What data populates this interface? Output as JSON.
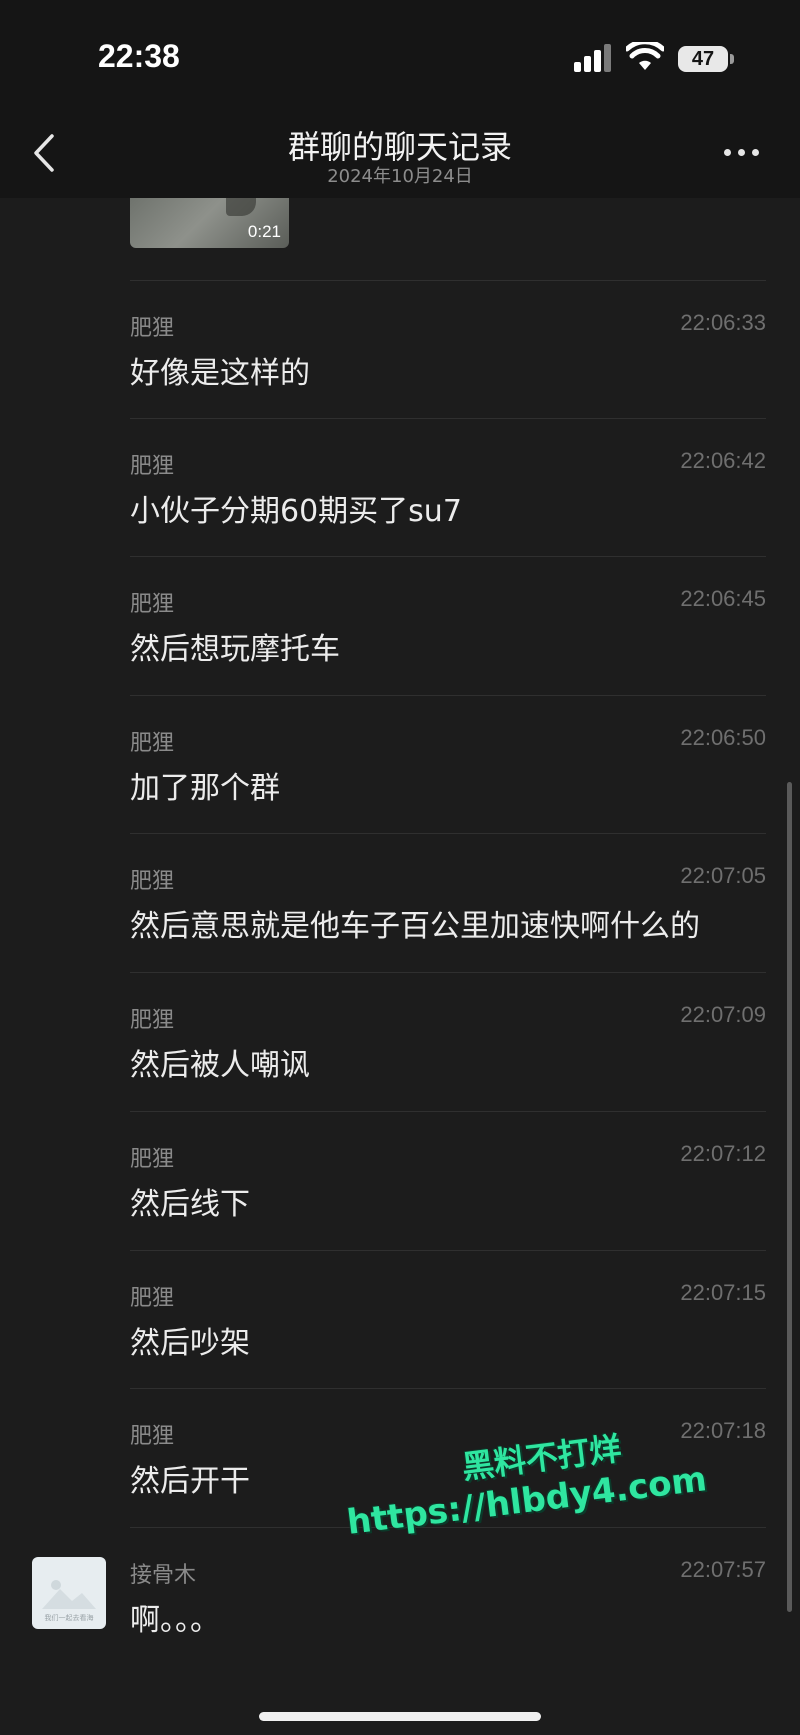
{
  "status_bar": {
    "time": "22:38",
    "battery": "47"
  },
  "nav": {
    "title": "群聊的聊天记录",
    "subtitle": "2024年10月24日"
  },
  "video": {
    "duration": "0:21"
  },
  "messages": [
    {
      "sender": "肥狸",
      "time": "22:06:33",
      "text": "好像是这样的"
    },
    {
      "sender": "肥狸",
      "time": "22:06:42",
      "text": "小伙子分期60期买了su7"
    },
    {
      "sender": "肥狸",
      "time": "22:06:45",
      "text": "然后想玩摩托车"
    },
    {
      "sender": "肥狸",
      "time": "22:06:50",
      "text": "加了那个群"
    },
    {
      "sender": "肥狸",
      "time": "22:07:05",
      "text": "然后意思就是他车子百公里加速快啊什么的"
    },
    {
      "sender": "肥狸",
      "time": "22:07:09",
      "text": "然后被人嘲讽"
    },
    {
      "sender": "肥狸",
      "time": "22:07:12",
      "text": "然后线下"
    },
    {
      "sender": "肥狸",
      "time": "22:07:15",
      "text": "然后吵架"
    },
    {
      "sender": "肥狸",
      "time": "22:07:18",
      "text": "然后开干"
    },
    {
      "sender": "接骨木",
      "time": "22:07:57",
      "text": "啊。。。"
    }
  ],
  "avatar": {
    "caption": "我们一起去看海"
  },
  "watermark": {
    "line1": "黑料不打烊",
    "line2": "https://hlbdy4.com"
  },
  "colors": {
    "background": "#1c1c1c",
    "header": "#151515",
    "watermark": "#2fe6a0"
  }
}
